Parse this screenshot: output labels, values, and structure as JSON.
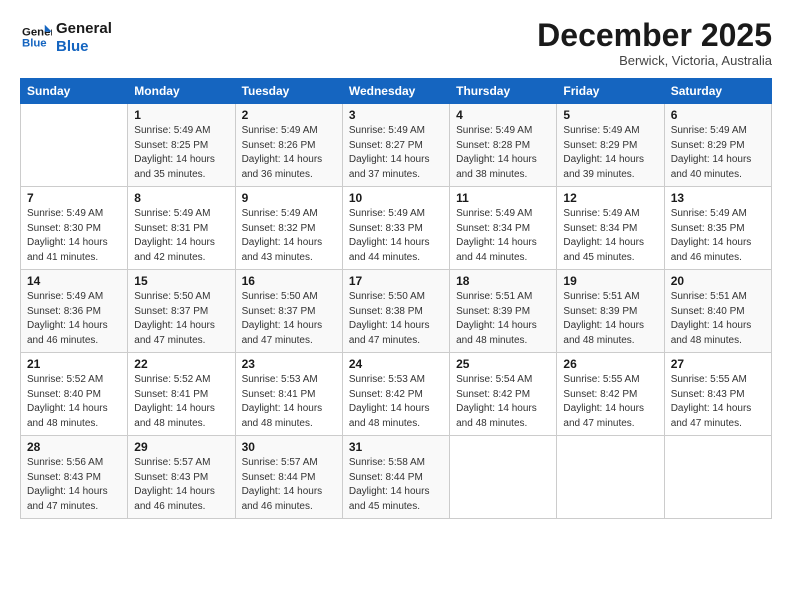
{
  "logo": {
    "line1": "General",
    "line2": "Blue"
  },
  "title": "December 2025",
  "subtitle": "Berwick, Victoria, Australia",
  "header": {
    "days": [
      "Sunday",
      "Monday",
      "Tuesday",
      "Wednesday",
      "Thursday",
      "Friday",
      "Saturday"
    ]
  },
  "weeks": [
    [
      {
        "num": "",
        "info": ""
      },
      {
        "num": "1",
        "info": "Sunrise: 5:49 AM\nSunset: 8:25 PM\nDaylight: 14 hours\nand 35 minutes."
      },
      {
        "num": "2",
        "info": "Sunrise: 5:49 AM\nSunset: 8:26 PM\nDaylight: 14 hours\nand 36 minutes."
      },
      {
        "num": "3",
        "info": "Sunrise: 5:49 AM\nSunset: 8:27 PM\nDaylight: 14 hours\nand 37 minutes."
      },
      {
        "num": "4",
        "info": "Sunrise: 5:49 AM\nSunset: 8:28 PM\nDaylight: 14 hours\nand 38 minutes."
      },
      {
        "num": "5",
        "info": "Sunrise: 5:49 AM\nSunset: 8:29 PM\nDaylight: 14 hours\nand 39 minutes."
      },
      {
        "num": "6",
        "info": "Sunrise: 5:49 AM\nSunset: 8:29 PM\nDaylight: 14 hours\nand 40 minutes."
      }
    ],
    [
      {
        "num": "7",
        "info": "Sunrise: 5:49 AM\nSunset: 8:30 PM\nDaylight: 14 hours\nand 41 minutes."
      },
      {
        "num": "8",
        "info": "Sunrise: 5:49 AM\nSunset: 8:31 PM\nDaylight: 14 hours\nand 42 minutes."
      },
      {
        "num": "9",
        "info": "Sunrise: 5:49 AM\nSunset: 8:32 PM\nDaylight: 14 hours\nand 43 minutes."
      },
      {
        "num": "10",
        "info": "Sunrise: 5:49 AM\nSunset: 8:33 PM\nDaylight: 14 hours\nand 44 minutes."
      },
      {
        "num": "11",
        "info": "Sunrise: 5:49 AM\nSunset: 8:34 PM\nDaylight: 14 hours\nand 44 minutes."
      },
      {
        "num": "12",
        "info": "Sunrise: 5:49 AM\nSunset: 8:34 PM\nDaylight: 14 hours\nand 45 minutes."
      },
      {
        "num": "13",
        "info": "Sunrise: 5:49 AM\nSunset: 8:35 PM\nDaylight: 14 hours\nand 46 minutes."
      }
    ],
    [
      {
        "num": "14",
        "info": "Sunrise: 5:49 AM\nSunset: 8:36 PM\nDaylight: 14 hours\nand 46 minutes."
      },
      {
        "num": "15",
        "info": "Sunrise: 5:50 AM\nSunset: 8:37 PM\nDaylight: 14 hours\nand 47 minutes."
      },
      {
        "num": "16",
        "info": "Sunrise: 5:50 AM\nSunset: 8:37 PM\nDaylight: 14 hours\nand 47 minutes."
      },
      {
        "num": "17",
        "info": "Sunrise: 5:50 AM\nSunset: 8:38 PM\nDaylight: 14 hours\nand 47 minutes."
      },
      {
        "num": "18",
        "info": "Sunrise: 5:51 AM\nSunset: 8:39 PM\nDaylight: 14 hours\nand 48 minutes."
      },
      {
        "num": "19",
        "info": "Sunrise: 5:51 AM\nSunset: 8:39 PM\nDaylight: 14 hours\nand 48 minutes."
      },
      {
        "num": "20",
        "info": "Sunrise: 5:51 AM\nSunset: 8:40 PM\nDaylight: 14 hours\nand 48 minutes."
      }
    ],
    [
      {
        "num": "21",
        "info": "Sunrise: 5:52 AM\nSunset: 8:40 PM\nDaylight: 14 hours\nand 48 minutes."
      },
      {
        "num": "22",
        "info": "Sunrise: 5:52 AM\nSunset: 8:41 PM\nDaylight: 14 hours\nand 48 minutes."
      },
      {
        "num": "23",
        "info": "Sunrise: 5:53 AM\nSunset: 8:41 PM\nDaylight: 14 hours\nand 48 minutes."
      },
      {
        "num": "24",
        "info": "Sunrise: 5:53 AM\nSunset: 8:42 PM\nDaylight: 14 hours\nand 48 minutes."
      },
      {
        "num": "25",
        "info": "Sunrise: 5:54 AM\nSunset: 8:42 PM\nDaylight: 14 hours\nand 48 minutes."
      },
      {
        "num": "26",
        "info": "Sunrise: 5:55 AM\nSunset: 8:42 PM\nDaylight: 14 hours\nand 47 minutes."
      },
      {
        "num": "27",
        "info": "Sunrise: 5:55 AM\nSunset: 8:43 PM\nDaylight: 14 hours\nand 47 minutes."
      }
    ],
    [
      {
        "num": "28",
        "info": "Sunrise: 5:56 AM\nSunset: 8:43 PM\nDaylight: 14 hours\nand 47 minutes."
      },
      {
        "num": "29",
        "info": "Sunrise: 5:57 AM\nSunset: 8:43 PM\nDaylight: 14 hours\nand 46 minutes."
      },
      {
        "num": "30",
        "info": "Sunrise: 5:57 AM\nSunset: 8:44 PM\nDaylight: 14 hours\nand 46 minutes."
      },
      {
        "num": "31",
        "info": "Sunrise: 5:58 AM\nSunset: 8:44 PM\nDaylight: 14 hours\nand 45 minutes."
      },
      {
        "num": "",
        "info": ""
      },
      {
        "num": "",
        "info": ""
      },
      {
        "num": "",
        "info": ""
      }
    ]
  ]
}
